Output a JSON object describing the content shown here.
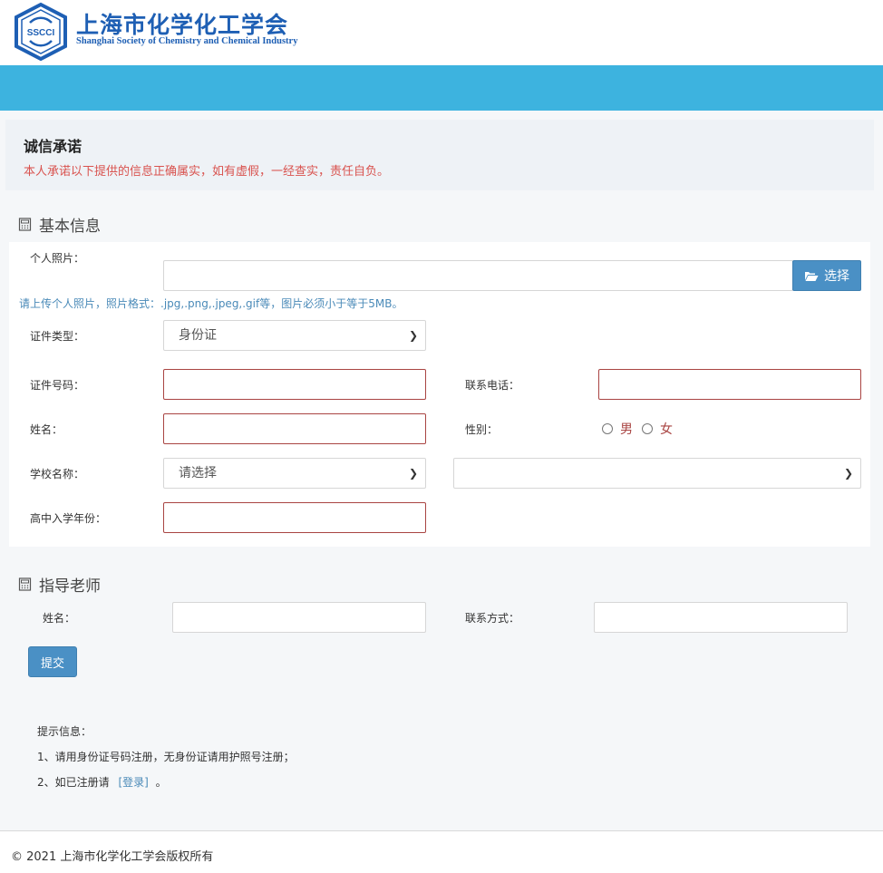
{
  "header": {
    "logo_abbr": "SSCCI",
    "org_name_cn": "上海市化学化工学会",
    "org_name_en": "Shanghai Society of Chemistry and Chemical Industry",
    "brand_color": "#1e5fb4",
    "banner_color": "#3db3df"
  },
  "pledge": {
    "title": "诚信承诺",
    "text": "本人承诺以下提供的信息正确属实，如有虚假，一经查实，责任自负。"
  },
  "basic_info": {
    "title": "基本信息",
    "photo_label": "个人照片：",
    "photo_value": "",
    "choose_button": "选择",
    "photo_hint": "请上传个人照片，照片格式：.jpg,.png,.jpeg,.gif等，图片必须小于等于5MB。",
    "id_type_label": "证件类型：",
    "id_type_value": "身份证",
    "id_number_label": "证件号码：",
    "id_number_value": "",
    "phone_label": "联系电话：",
    "phone_value": "",
    "name_label": "姓名：",
    "name_value": "",
    "gender_label": "性别：",
    "gender_options": [
      "男",
      "女"
    ],
    "school_label": "学校名称：",
    "school_select_1": "请选择",
    "school_select_2": "",
    "enroll_year_label": "高中入学年份：",
    "enroll_year_value": ""
  },
  "teacher": {
    "title": "指导老师",
    "name_label": "姓名：",
    "name_value": "",
    "contact_label": "联系方式：",
    "contact_value": ""
  },
  "submit_label": "提交",
  "tips": {
    "heading": "提示信息：",
    "line1": "1、请用身份证号码注册，无身份证请用护照号注册；",
    "line2_prefix": "2、如已注册请",
    "line2_link": "[登录]",
    "line2_suffix": "。"
  },
  "footer": {
    "copyright": "© 2021 上海市化学化工学会版权所有"
  }
}
